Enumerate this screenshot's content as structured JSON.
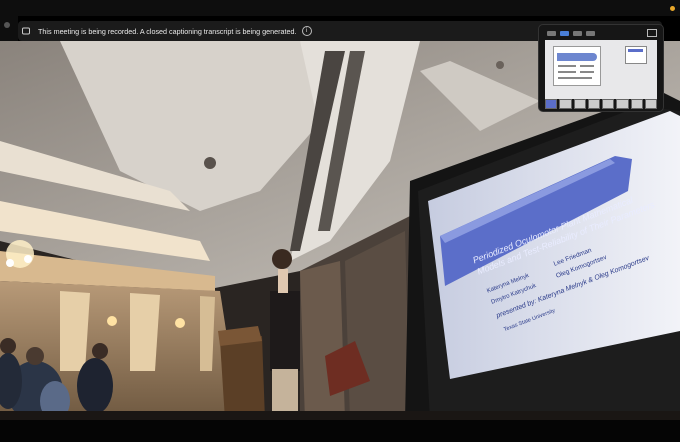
{
  "banner": {
    "text": "This meeting is being recorded. A closed captioning transcript is being generated.",
    "info_glyph": "i"
  },
  "slide": {
    "title_line1": "Periodized Oculomotor Plant Mathematical",
    "title_line2": "Models and Test-Reliability of Their Parameters",
    "authors_row1_left": "Kateryna Melnyk",
    "authors_row1_right": "Lee Friedman",
    "authors_row2_left": "Dmytro Katrychuk",
    "authors_row2_right": "Oleg Komogortsev",
    "presented_by": "presented by: Kateryna Melnyk & Oleg Komogortsev",
    "university": "Texas State University"
  },
  "colors": {
    "accent_blue": "#5b6ec9",
    "recording_dot": "#e8a72a",
    "banner_bg": "#1b1b1b"
  },
  "icons": {
    "banner": "record-icon",
    "info": "info-icon"
  }
}
